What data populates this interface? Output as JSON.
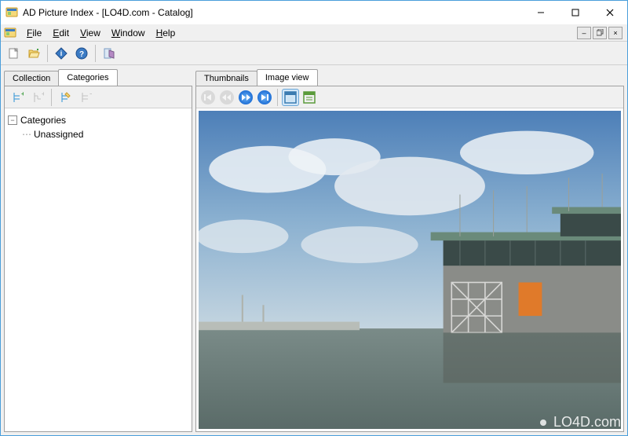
{
  "title": "AD Picture Index - [LO4D.com - Catalog]",
  "menu": {
    "file": "File",
    "edit": "Edit",
    "view": "View",
    "window": "Window",
    "help": "Help"
  },
  "left_tabs": {
    "collection": "Collection",
    "categories": "Categories"
  },
  "right_tabs": {
    "thumbnails": "Thumbnails",
    "image_view": "Image view"
  },
  "tree": {
    "root": "Categories",
    "child": "Unassigned"
  },
  "watermark": "LO4D.com",
  "colors": {
    "accent": "#4a9edb",
    "nav_blue": "#1e6fd6",
    "nav_gray": "#9a9a9a"
  }
}
